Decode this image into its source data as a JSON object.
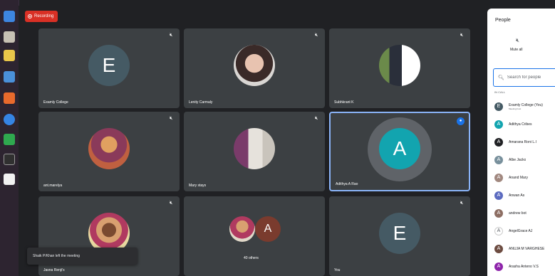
{
  "recording": {
    "label": "Recording",
    "color": "#d93025"
  },
  "toast": {
    "text": "Shaik P/Khan left the meeting"
  },
  "tiles": [
    {
      "name": "Examly College",
      "initial": "E",
      "avatar_color": "#455a64",
      "kind": "initial",
      "muted": true
    },
    {
      "name": "Lenity Carmaly",
      "kind": "photo",
      "muted": true
    },
    {
      "name": "Subhkrant K",
      "kind": "photo",
      "muted": true
    },
    {
      "name": "ant.marelya",
      "kind": "photo",
      "muted": true
    },
    {
      "name": "Mary stays",
      "kind": "photo",
      "muted": true
    },
    {
      "name": "Adithya A Rao",
      "initial": "A",
      "avatar_color": "#12a4af",
      "kind": "initial",
      "speaking": true
    },
    {
      "name": "Jasna Renji's",
      "kind": "photo",
      "muted": true
    },
    {
      "name": "40 others",
      "initial": "A",
      "avatar_color": "#7a3b2e",
      "kind": "others"
    },
    {
      "name": "You",
      "initial": "E",
      "avatar_color": "#455a64",
      "kind": "initial",
      "muted": true
    }
  ],
  "people_panel": {
    "title": "People",
    "mute_all_label": "Mute all",
    "search_placeholder": "Search for people",
    "section_label": "IN CALL",
    "participants": [
      {
        "name": "Examly College (You)",
        "sub": "Meeting host",
        "initial": "E",
        "color": "#455a64"
      },
      {
        "name": "Adithya Cribes",
        "initial": "A",
        "color": "#12a4af"
      },
      {
        "name": "Amarana Roni L.I",
        "initial": "A",
        "color": "#202124"
      },
      {
        "name": "Albe Jacko",
        "initial": "A",
        "color": "#78909c"
      },
      {
        "name": "Anand Mary",
        "initial": "A",
        "color": "#a1887f"
      },
      {
        "name": "Anwan As",
        "initial": "A",
        "color": "#5c6bc0"
      },
      {
        "name": "andrew bot",
        "initial": "A",
        "color": "#8d6e63"
      },
      {
        "name": "AngelGrace AJ",
        "initial": "A",
        "color": "#ffffff"
      },
      {
        "name": "ANUJA M VARGHESE",
        "initial": "A",
        "color": "#6d4c41"
      },
      {
        "name": "Arasha Anteno V.S",
        "initial": "A",
        "color": "#8e24aa"
      }
    ]
  }
}
